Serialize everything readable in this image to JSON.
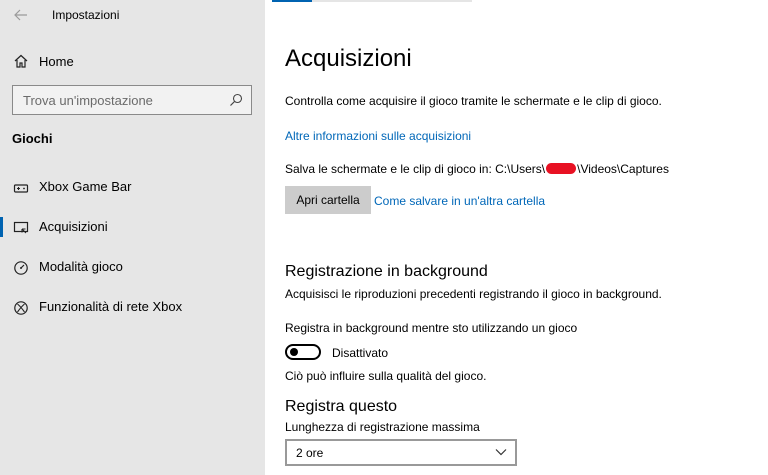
{
  "window": {
    "title": "Impostazioni",
    "back_icon": "arrow-left-icon"
  },
  "sidebar": {
    "home_label": "Home",
    "search_placeholder": "Trova un'impostazione",
    "section_title": "Giochi",
    "items": [
      {
        "label": "Xbox Game Bar",
        "icon": "game-bar-icon"
      },
      {
        "label": "Acquisizioni",
        "icon": "captures-icon",
        "active": true
      },
      {
        "label": "Modalità gioco",
        "icon": "game-mode-icon"
      },
      {
        "label": "Funzionalità di rete Xbox",
        "icon": "xbox-icon"
      }
    ]
  },
  "main": {
    "title": "Acquisizioni",
    "description": "Controlla come acquisire il gioco tramite le schermate e le clip di gioco.",
    "more_info_link": "Altre informazioni sulle acquisizioni",
    "save_path_prefix": "Salva le schermate e le clip di gioco in: C:\\Users\\",
    "save_path_suffix": "\\Videos\\Captures",
    "open_folder_button": "Apri cartella",
    "save_elsewhere_link": "Come salvare in un'altra cartella",
    "background": {
      "heading": "Registrazione in background",
      "description": "Acquisisci le riproduzioni precedenti registrando il gioco in background.",
      "toggle_label": "Registra in background mentre sto utilizzando un gioco",
      "toggle_state": "Disattivato",
      "note": "Ciò può influire sulla qualità del gioco."
    },
    "record_this": {
      "heading": "Registra questo",
      "max_length_label": "Lunghezza di registrazione massima",
      "max_length_value": "2 ore"
    }
  },
  "colors": {
    "accent": "#0063b1",
    "link": "#0067b8",
    "sidebar_bg": "#e6e6e6",
    "redaction": "#e81123"
  }
}
